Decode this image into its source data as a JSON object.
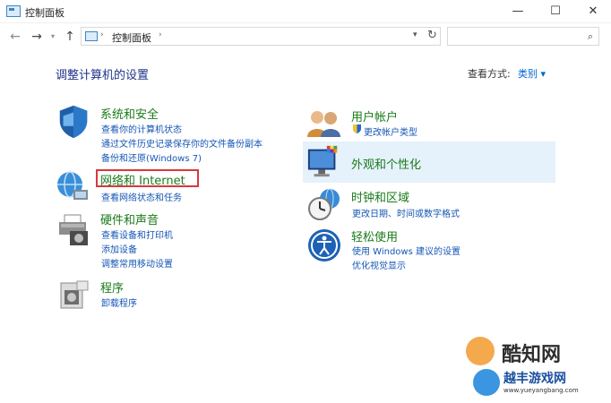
{
  "window": {
    "title": "控制面板",
    "min": "—",
    "max": "☐",
    "close": "✕"
  },
  "nav": {
    "back": "←",
    "forward": "→",
    "recent": "▾",
    "up": "↑"
  },
  "address": {
    "sep": "›",
    "crumb": "控制面板",
    "dropdown": "▾",
    "refresh": "↻"
  },
  "search": {
    "placeholder": "",
    "icon": "⌕"
  },
  "page_title": "调整计算机的设置",
  "view_by": {
    "label": "查看方式:",
    "value": "类别 ▾"
  },
  "categories_left": [
    {
      "title": "系统和安全",
      "icon": "shield-icon",
      "links": [
        "查看你的计算机状态",
        "通过文件历史记录保存你的文件备份副本",
        "备份和还原(Windows 7)"
      ]
    },
    {
      "title": "网络和 Internet",
      "icon": "network-globe-icon",
      "links": [
        "查看网络状态和任务"
      ]
    },
    {
      "title": "硬件和声音",
      "icon": "printer-icon",
      "links": [
        "查看设备和打印机",
        "添加设备",
        "调整常用移动设置"
      ]
    },
    {
      "title": "程序",
      "icon": "programs-icon",
      "links": [
        "卸载程序"
      ]
    }
  ],
  "categories_right": [
    {
      "title": "用户帐户",
      "icon": "users-icon",
      "links": [
        "更改帐户类型"
      ]
    },
    {
      "title": "外观和个性化",
      "icon": "monitor-palette-icon",
      "links": []
    },
    {
      "title": "时钟和区域",
      "icon": "clock-globe-icon",
      "links": [
        "更改日期、时间或数字格式"
      ]
    },
    {
      "title": "轻松使用",
      "icon": "ease-of-access-icon",
      "links": [
        "使用 Windows 建议的设置",
        "优化视觉显示"
      ]
    }
  ],
  "watermark": {
    "brand1": "酷知网",
    "brand2": "越丰游戏网",
    "url": "www.yueyangbang.com"
  },
  "colors": {
    "accent": "#1556b5",
    "category_title": "#1a7a1a",
    "highlight": "#e5f1fb",
    "red_box": "#d9383c"
  }
}
